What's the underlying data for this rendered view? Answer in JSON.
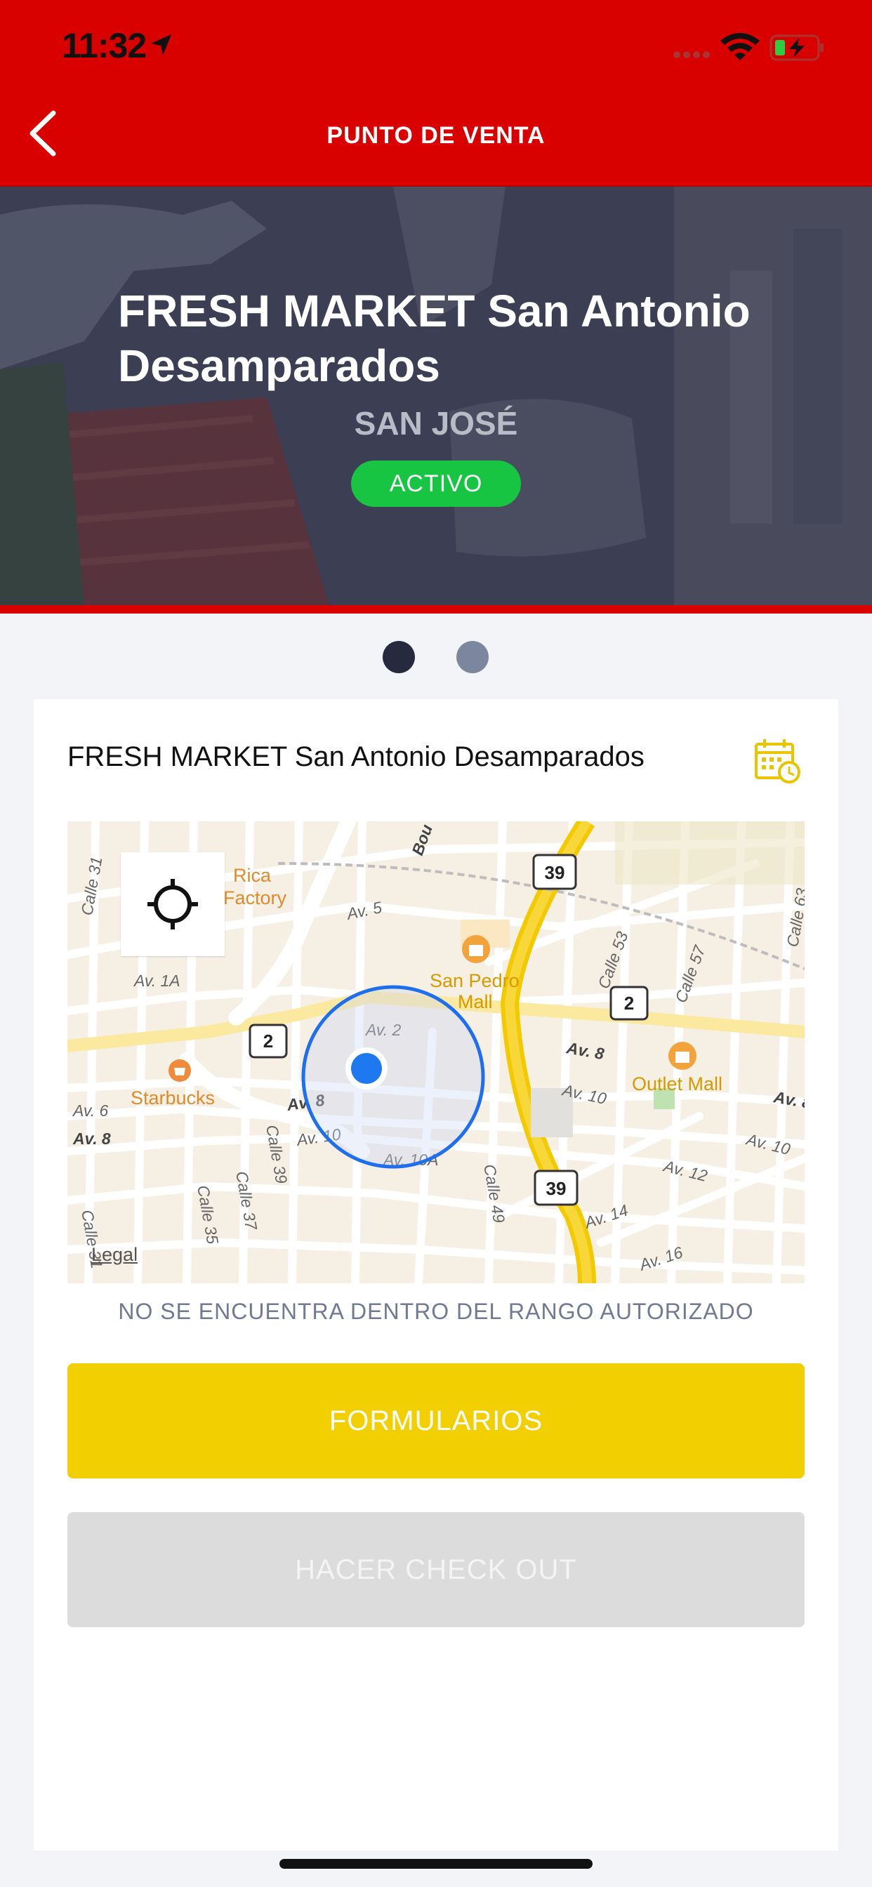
{
  "status_bar": {
    "time": "11:32"
  },
  "header": {
    "title": "PUNTO DE VENTA"
  },
  "hero": {
    "store_name": "FRESH MARKET San Antonio Desamparados",
    "city": "SAN JOSÉ",
    "status": "ACTIVO"
  },
  "card": {
    "store_name": "FRESH MARKET San Antonio Desamparados"
  },
  "map": {
    "legal": "Legal",
    "labels": {
      "calle31a": "Calle 31",
      "calle31b": "Calle 31",
      "calle35": "Calle 35",
      "calle37": "Calle 37",
      "calle39": "Calle 39",
      "calle49": "Calle 49",
      "calle53": "Calle 53",
      "calle57": "Calle 57",
      "calle63": "Calle 63",
      "av1a": "Av. 1A",
      "av2": "Av. 2",
      "av5": "Av. 5",
      "av6": "Av. 6",
      "av8a": "Av. 8",
      "av8b": "Av. 8",
      "av8c": "Av. 8",
      "av8d": "Av. 8",
      "av10a": "Av. 10",
      "av10b": "Av. 10",
      "av10c": "Av. 10",
      "av10A": "Av. 10A",
      "av12": "Av. 12",
      "av14": "Av. 14",
      "av16": "Av. 16",
      "bou": "Bou",
      "rica": "Rica",
      "factory": "Factory",
      "starbucks": "Starbucks",
      "sanpedro": "San Pedro",
      "mall": "Mall",
      "outletmall": "Outlet Mall",
      "shield39a": "39",
      "shield39b": "39",
      "shield2a": "2",
      "shield2b": "2"
    }
  },
  "range_message": "NO SE ENCUENTRA DENTRO DEL RANGO AUTORIZADO",
  "buttons": {
    "forms": "FORMULARIOS",
    "checkout": "HACER CHECK OUT"
  },
  "colors": {
    "header_red": "#d90000",
    "status_green": "#17c542",
    "forms_yellow": "#f2cf00",
    "disabled_gray": "#dcdcdc",
    "location_blue": "#1e78f0"
  }
}
